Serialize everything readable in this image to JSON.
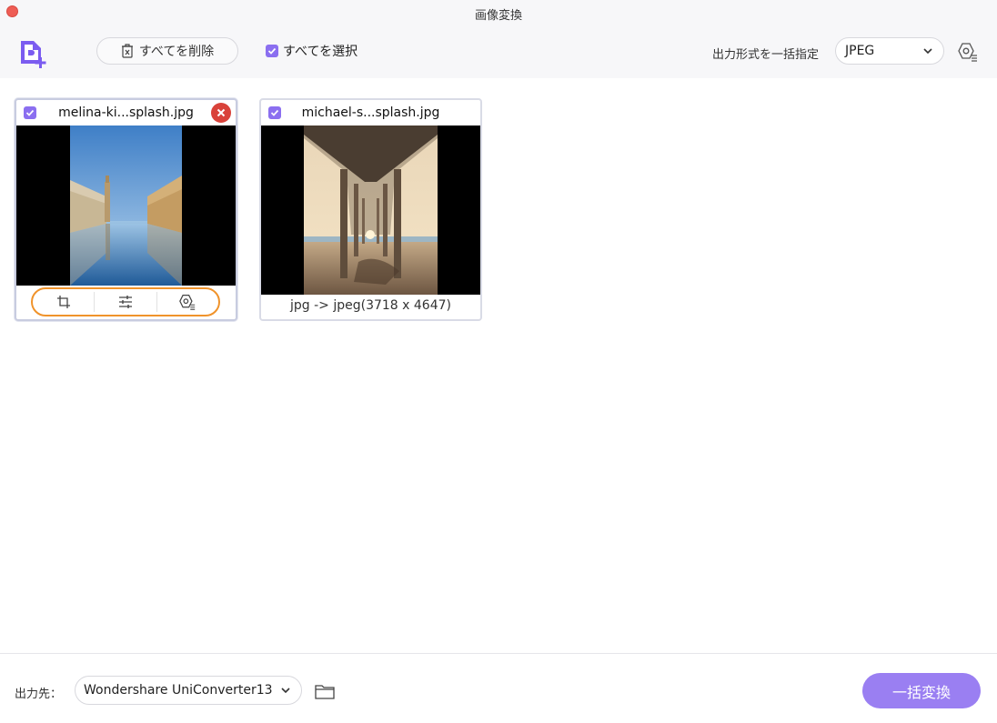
{
  "window": {
    "title": "画像変換"
  },
  "toolbar": {
    "delete_all_label": "すべてを削除",
    "select_all_label": "すべてを選択",
    "format_label": "出力形式を一括指定",
    "format_value": "JPEG"
  },
  "files": [
    {
      "name": "melina-ki...splash.jpg",
      "checked": true,
      "selected": true
    },
    {
      "name": "michael-s...splash.jpg",
      "checked": true,
      "conversion": "jpg -> jpeg(3718 x 4647)"
    }
  ],
  "footer": {
    "output_label": "出力先：",
    "output_path": "Wondershare UniConverter13",
    "convert_label": "一括変換"
  },
  "colors": {
    "accent": "#8b6ff0",
    "convert_button": "#9a7ff2",
    "remove": "#d9423a",
    "highlight": "#f0932b"
  }
}
